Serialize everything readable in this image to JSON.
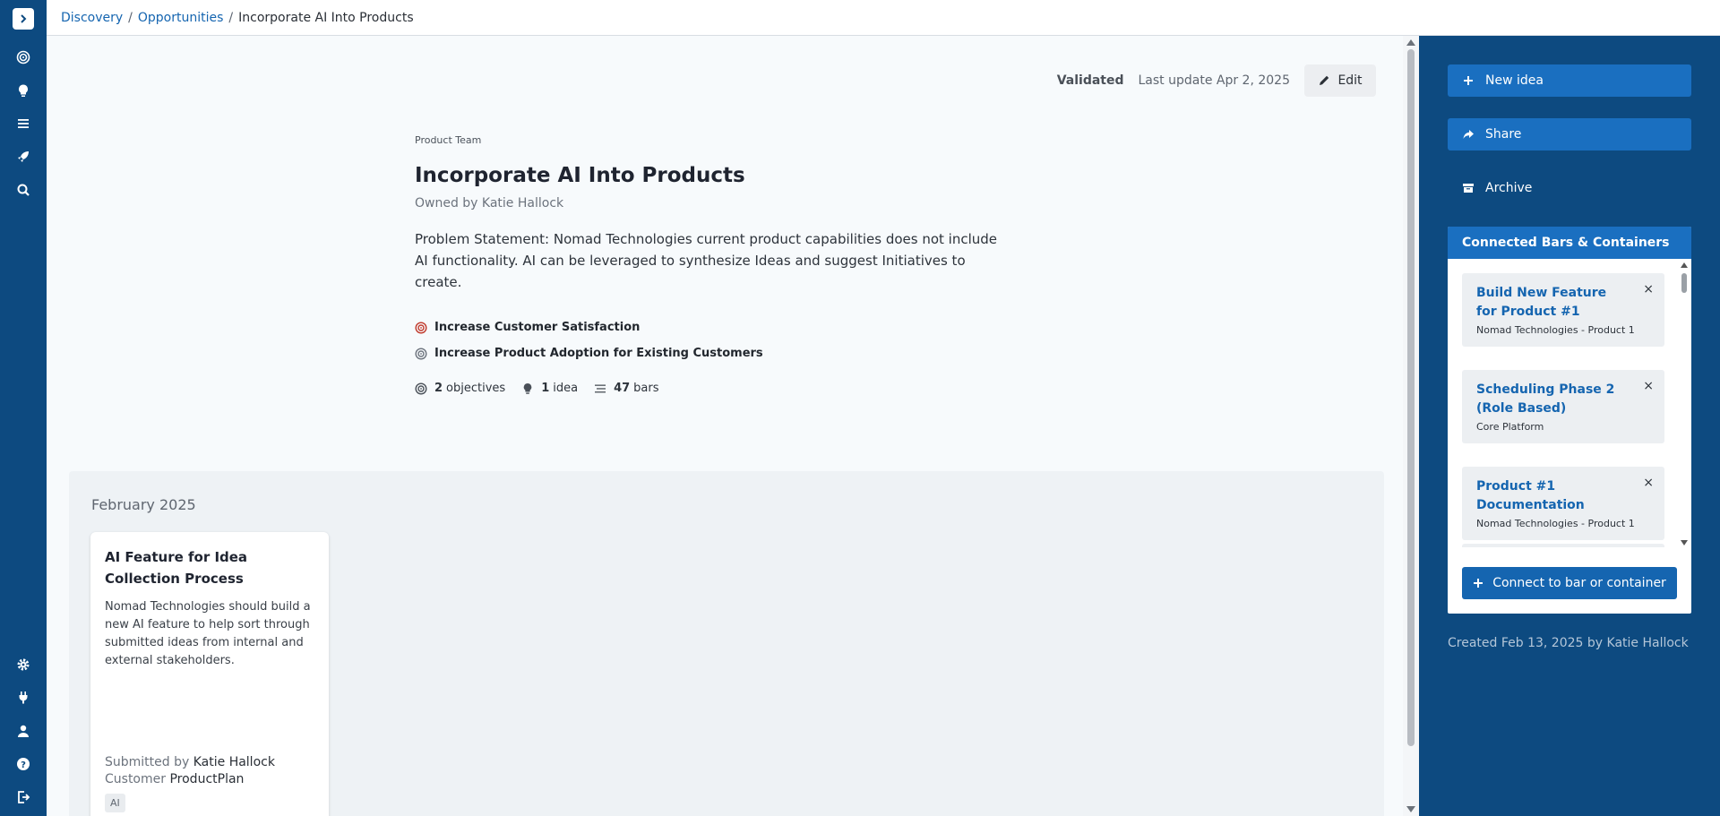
{
  "breadcrumb": {
    "items": [
      "Discovery",
      "Opportunities"
    ],
    "current": "Incorporate AI Into Products",
    "separator": "/"
  },
  "status": {
    "validated": "Validated",
    "last_update": "Last update Apr 2, 2025",
    "edit_label": "Edit"
  },
  "opportunity": {
    "team": "Product Team",
    "title": "Incorporate AI Into Products",
    "owner": "Owned by Katie Hallock",
    "problem_statement": "Problem Statement: Nomad Technologies current product capabilities does not include AI functionality. AI can be leveraged to synthesize Ideas and suggest Initiatives to create.",
    "objectives": [
      "Increase Customer Satisfaction",
      "Increase Product Adoption for Existing Customers"
    ],
    "counts": {
      "objectives_num": "2",
      "objectives_label": "objectives",
      "ideas_num": "1",
      "ideas_label": "idea",
      "bars_num": "47",
      "bars_label": "bars"
    }
  },
  "ideas": {
    "month": "February 2025",
    "card": {
      "title": "AI Feature for Idea Collection Process",
      "description": "Nomad Technologies should build a new AI feature to help sort through submitted ideas from internal and external stakeholders.",
      "submitted_label": "Submitted by",
      "submitted_value": "Katie Hallock",
      "customer_label": "Customer",
      "customer_value": "ProductPlan",
      "tag": "AI"
    }
  },
  "sidebar_right": {
    "new_idea": "New idea",
    "share": "Share",
    "archive": "Archive",
    "connected_title": "Connected Bars & Containers",
    "connected": [
      {
        "name": "Build New Feature for Product #1",
        "sub": "Nomad Technologies - Product 1"
      },
      {
        "name": "Scheduling Phase 2 (Role Based)",
        "sub": "Core Platform"
      },
      {
        "name": "Product #1 Documentation",
        "sub": "Nomad Technologies - Product 1"
      }
    ],
    "close_glyph": "×",
    "connect_label": "Connect to bar or container",
    "created": "Created Feb 13, 2025 by Katie Hallock"
  },
  "colors": {
    "nav_bg": "#0d4a80",
    "accent": "#1a6fc0",
    "link": "#1565b0",
    "objective_red": "#c0392b",
    "objective_gray": "#6c737d"
  },
  "icons": {
    "left_nav": [
      "target-icon",
      "lightbulb-icon",
      "list-icon",
      "rocket-icon",
      "search-icon",
      "gear-icon",
      "plug-icon",
      "user-icon",
      "help-icon",
      "logout-icon"
    ]
  }
}
